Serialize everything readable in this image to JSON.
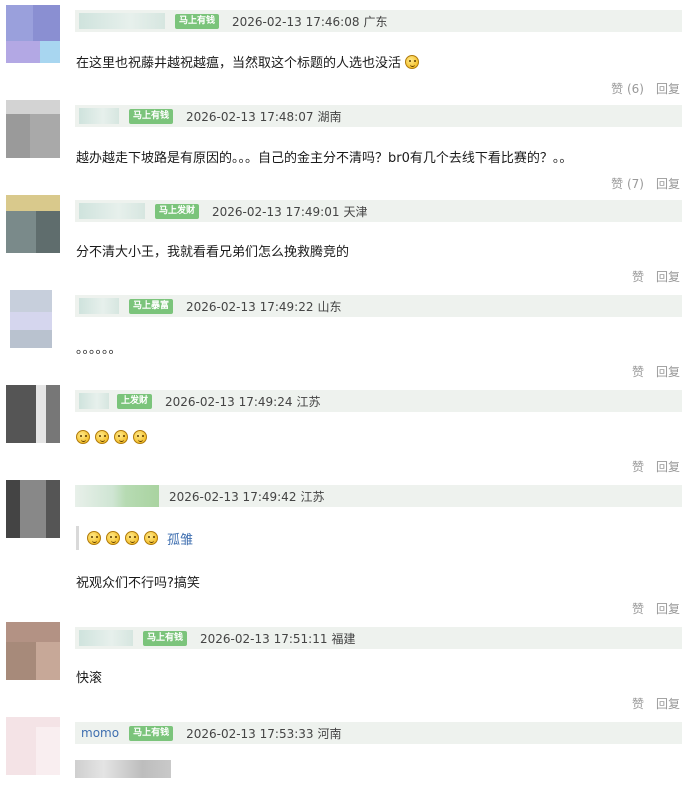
{
  "colors": {
    "badge": "#7bc47b",
    "header_bg": "#eef2ee",
    "action": "#999999",
    "link": "#3f6fb0"
  },
  "actions": {
    "reply": "回复"
  },
  "comments": [
    {
      "badge": "马上有钱",
      "time": "2026-02-13 17:46:08",
      "location": "广东",
      "text": "在这里也祝藤井越祝越瘟，当然取这个标题的人选也没活",
      "like": "赞 (6)"
    },
    {
      "badge": "马上有钱",
      "time": "2026-02-13 17:48:07",
      "location": "湖南",
      "text": "越办越走下坡路是有原因的。。。自己的金主分不清吗？br0有几个去线下看比赛的？。。",
      "like": "赞 (7)"
    },
    {
      "badge": "马上发财",
      "time": "2026-02-13 17:49:01",
      "location": "天津",
      "text": "分不清大小王，我就看看兄弟们怎么挽救腾竞的",
      "like": "赞"
    },
    {
      "badge": "马上暴富",
      "time": "2026-02-13 17:49:22",
      "location": "山东",
      "text": "。。。。。。",
      "like": "赞"
    },
    {
      "badge": "上发财",
      "time": "2026-02-13 17:49:24",
      "location": "江苏",
      "text": "",
      "like": "赞"
    },
    {
      "badge": "",
      "time": "2026-02-13 17:49:42",
      "location": "江苏",
      "quote_name": "孤雏",
      "text": "祝观众们不行吗?搞笑",
      "like": "赞"
    },
    {
      "badge": "马上有钱",
      "time": "2026-02-13 17:51:11",
      "location": "福建",
      "text": "快滚",
      "like": "赞"
    },
    {
      "username": "momo",
      "badge": "马上有钱",
      "time": "2026-02-13 17:53:33",
      "location": "河南"
    }
  ]
}
